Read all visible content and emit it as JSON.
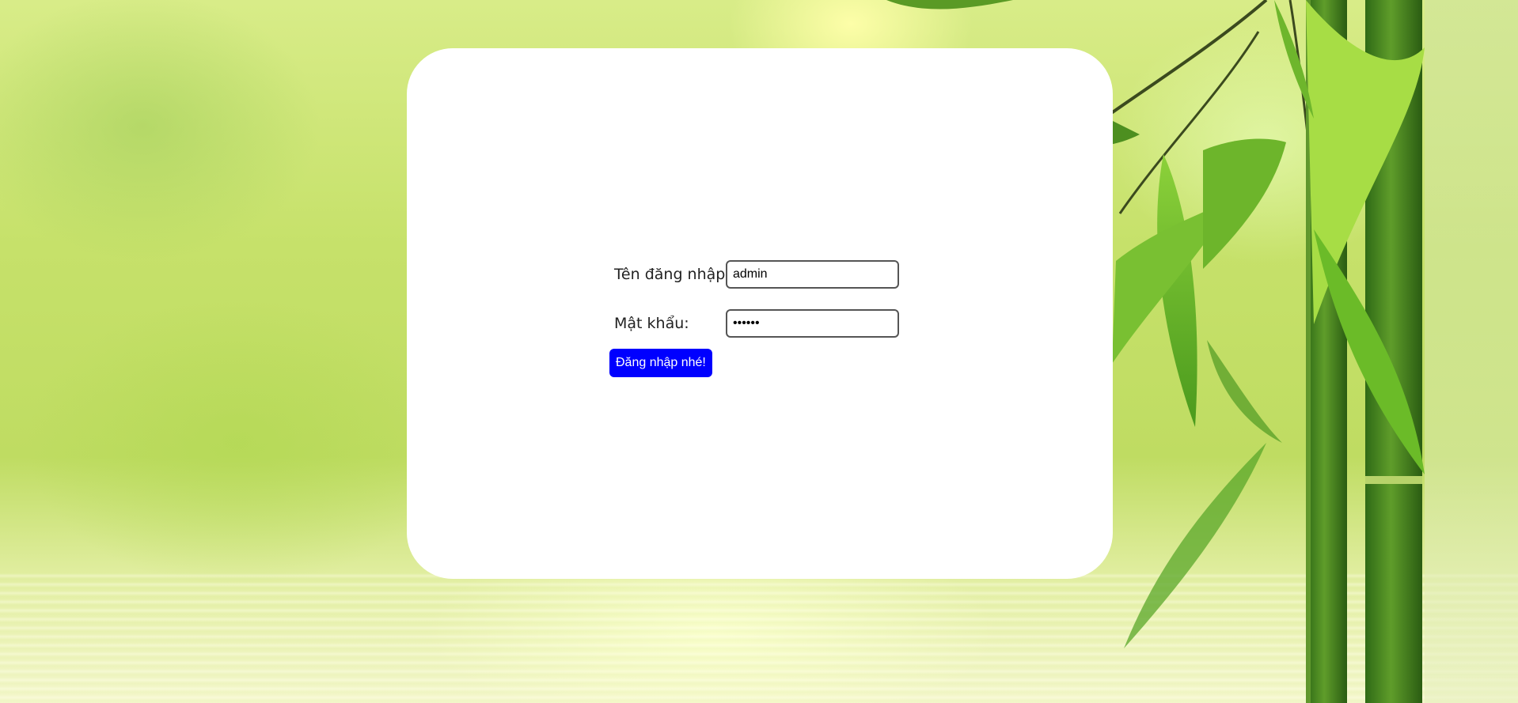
{
  "login": {
    "username_label": "Tên đăng nhập:",
    "username_value": "admin",
    "password_label": "Mật khẩu:",
    "password_value": "123456",
    "submit_label": "Đăng nhập nhé!"
  },
  "colors": {
    "button_background": "#0000ff",
    "button_text": "#ffffff",
    "card_background": "#ffffff"
  }
}
